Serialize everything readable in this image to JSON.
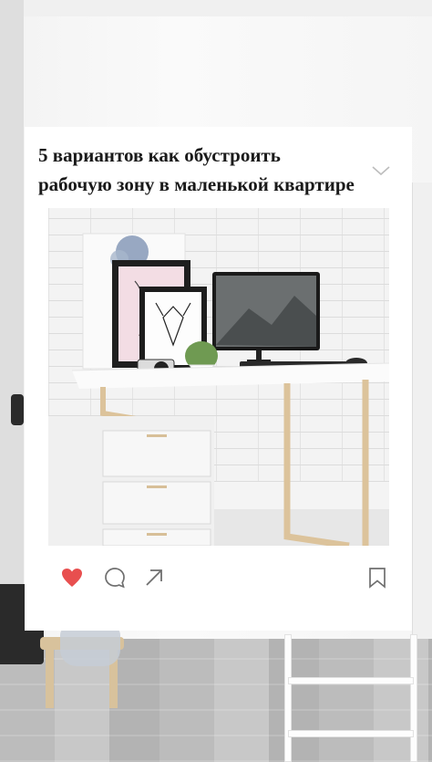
{
  "post": {
    "title_lines": [
      "5 вариантов как обустроить",
      "рабочую зону в маленькой квартире"
    ]
  },
  "icons": {
    "expand": "chevron-down-icon",
    "like": "heart-icon",
    "comment": "comment-icon",
    "share": "share-arrow-icon",
    "save": "bookmark-icon"
  },
  "colors": {
    "like_active": "#e84f4f",
    "icon_stroke": "#6f6f6f",
    "card_background": "#ffffff",
    "title_text": "#1a1a1a"
  },
  "state": {
    "liked": true
  }
}
